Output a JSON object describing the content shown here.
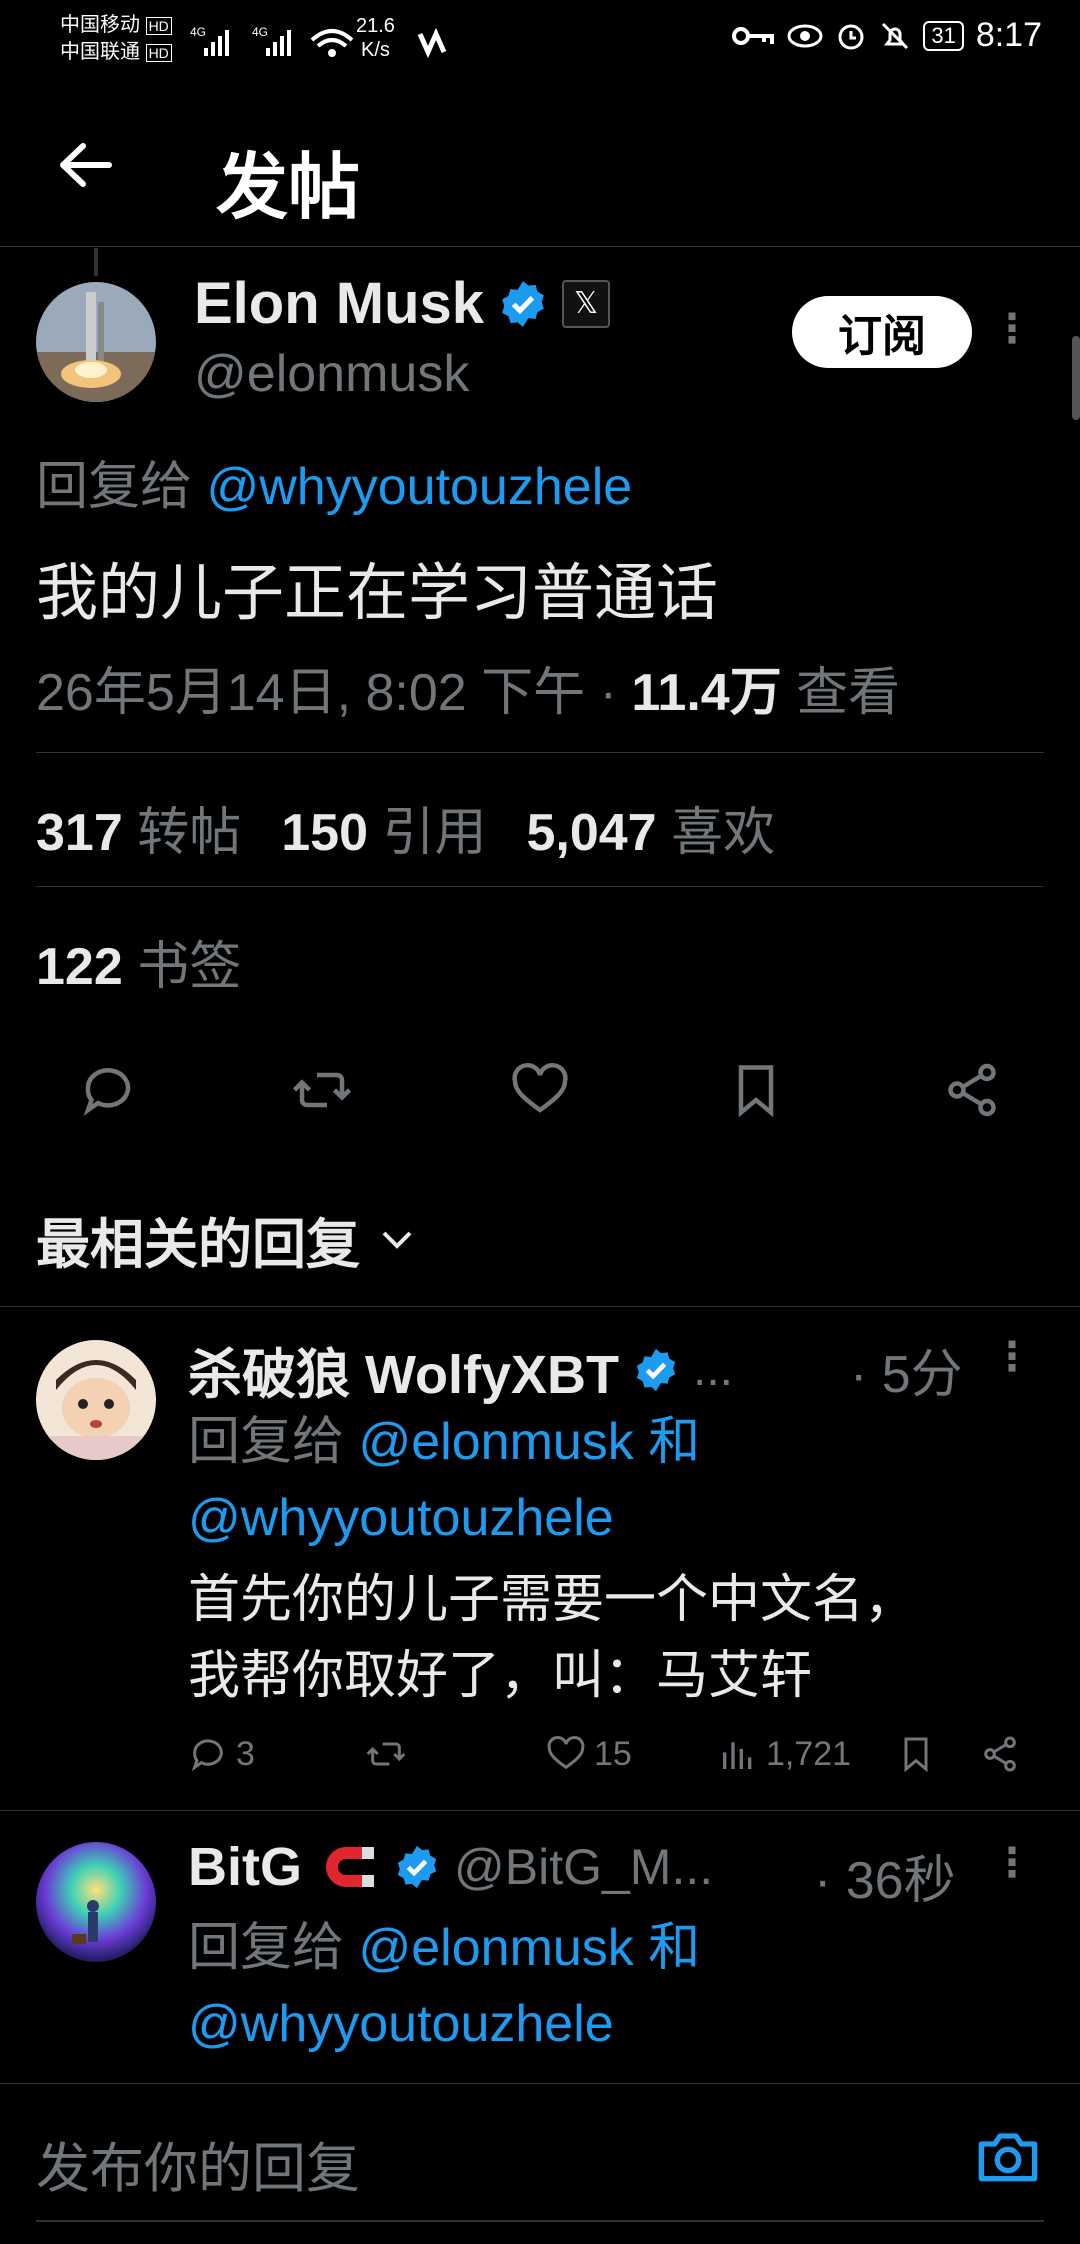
{
  "status_bar": {
    "carrier1": "中国移动",
    "carrier2": "中国联通",
    "speed": "21.6",
    "speed_unit": "K/s",
    "battery": "31",
    "time": "8:17"
  },
  "header": {
    "title": "发帖"
  },
  "tweet": {
    "author_name": "Elon Musk",
    "handle": "@elonmusk",
    "subscribe_label": "订阅",
    "reply_prefix": "回复给",
    "reply_to": "@whyyoutouzhele",
    "text": "我的儿子正在学习普通话",
    "timestamp": "26年5月14日, 8:02 下午 ·",
    "views_count": "11.4万",
    "views_label": "查看",
    "retweets_count": "317",
    "retweets_label": "转帖",
    "quotes_count": "150",
    "quotes_label": "引用",
    "likes_count": "5,047",
    "likes_label": "喜欢",
    "bookmarks_count": "122",
    "bookmarks_label": "书签"
  },
  "replies_sort": {
    "label": "最相关的回复"
  },
  "replies": [
    {
      "name": "杀破狼 WolfyXBT",
      "ellipsis": "...",
      "time": "· 5分",
      "reply_prefix": "回复给",
      "reply_to_1": "@elonmusk",
      "and": "和",
      "reply_to_2": "@whyyoutouzhele",
      "text_line1": "首先你的儿子需要一个中文名，",
      "text_line2": "我帮你取好了，叫：马艾轩",
      "comments": "3",
      "likes": "15",
      "views": "1,721"
    },
    {
      "name": "BitG",
      "handle": "@BitG_M...",
      "time": "· 36秒",
      "reply_prefix": "回复给",
      "reply_to_1": "@elonmusk",
      "and": "和",
      "reply_to_2": "@whyyoutouzhele"
    }
  ],
  "composer": {
    "placeholder": "发布你的回复"
  },
  "colors": {
    "accent": "#1d9bf0",
    "muted": "#71767b",
    "divider": "#2f3336",
    "subscribe_magnet": "#e0262f"
  }
}
